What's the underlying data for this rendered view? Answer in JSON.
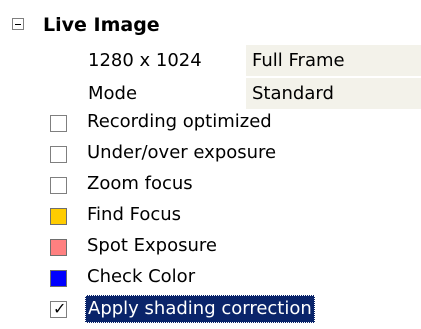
{
  "section": {
    "title": "Live Image",
    "expanded": true
  },
  "properties": [
    {
      "name": "1280 x 1024",
      "value": "Full Frame"
    },
    {
      "name": "Mode",
      "value": "Standard"
    }
  ],
  "options": [
    {
      "label": "Recording optimized",
      "checked": false,
      "swatch": "#ffffff"
    },
    {
      "label": "Under/over exposure",
      "checked": false,
      "swatch": "#ffffff"
    },
    {
      "label": "Zoom focus",
      "checked": false,
      "swatch": "#ffffff"
    },
    {
      "label": "Find Focus",
      "checked": false,
      "swatch": "#ffcc00"
    },
    {
      "label": "Spot Exposure",
      "checked": false,
      "swatch": "#ff8080"
    },
    {
      "label": "Check Color",
      "checked": false,
      "swatch": "#0000ff"
    },
    {
      "label": "Apply shading correction",
      "checked": true,
      "selected": true,
      "swatch": "#ffffff"
    }
  ],
  "colors": {
    "selection_background": "#0a246a",
    "selection_text": "#ffffff",
    "value_background": "#f3f2ea"
  }
}
